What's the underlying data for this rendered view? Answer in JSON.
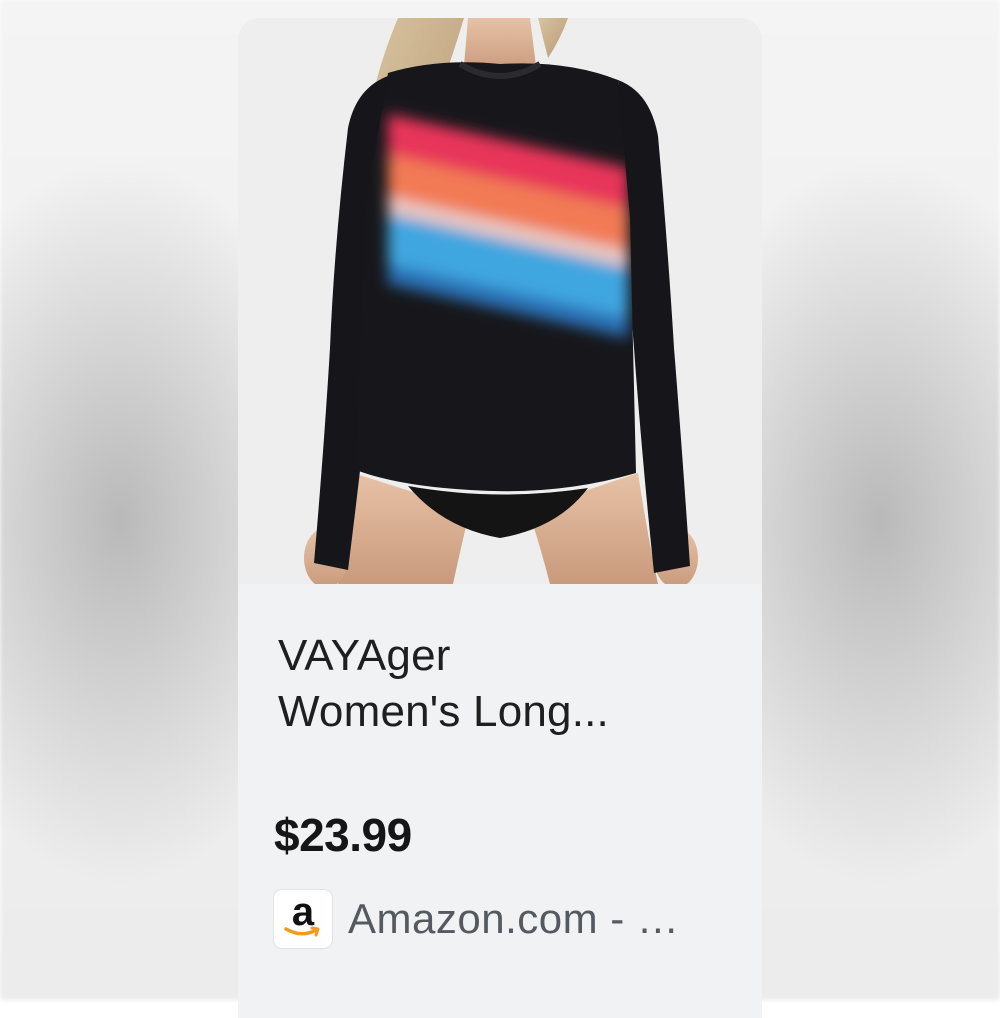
{
  "listing": {
    "image_icon": "product-photo",
    "title_line1": "VAYAger",
    "title_line2": "Women's Long...",
    "price": "$23.99",
    "source": {
      "logo_icon": "amazon-icon",
      "logo_letter": "a",
      "text": "Amazon.com - …"
    }
  },
  "colors": {
    "card_background": "#f1f2f4",
    "price_text": "#161616",
    "source_text": "#555a60"
  }
}
